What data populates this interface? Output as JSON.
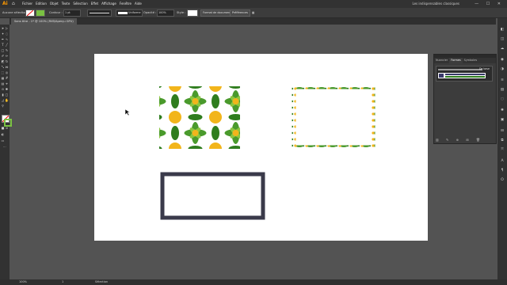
{
  "app": {
    "logo": "Ai",
    "home_icon": "home-icon"
  },
  "menu": [
    "Fichier",
    "Edition",
    "Objet",
    "Texte",
    "Sélection",
    "Effet",
    "Affichage",
    "Fenêtre",
    "Aide"
  ],
  "workspace": "Les indispensables classiques",
  "window_controls": "— ☐ ✕",
  "control_bar": {
    "selection_state": "Aucune sélection",
    "stroke_label": "Contour :",
    "stroke_value": "1 pt",
    "brush_name": "Uniforme",
    "opacity_label": "Opacité :",
    "opacity_value": "100%",
    "style_label": "Style :",
    "doc_format_button": "Format de document",
    "preferences_button": "Préférences"
  },
  "document_tab": "Sans titre - 1* @ 100% (RVB/Aperçu GPU)",
  "panel": {
    "tabs": [
      "Nuancier",
      "Formes",
      "Symboles"
    ],
    "active_tab": "Formes",
    "brush_label": "De base",
    "footer_icons": "▥ ✎ ⊕ ⊞ 🗑"
  },
  "status": {
    "zoom": "100%",
    "page": "1",
    "tool": "Sélection"
  },
  "colors": {
    "app_bg": "#535353",
    "artboard": "#ffffff",
    "pattern_green": "#4a9a2c",
    "pattern_yellow": "#f2b51b",
    "rect_stroke": "#3a3a4a"
  }
}
